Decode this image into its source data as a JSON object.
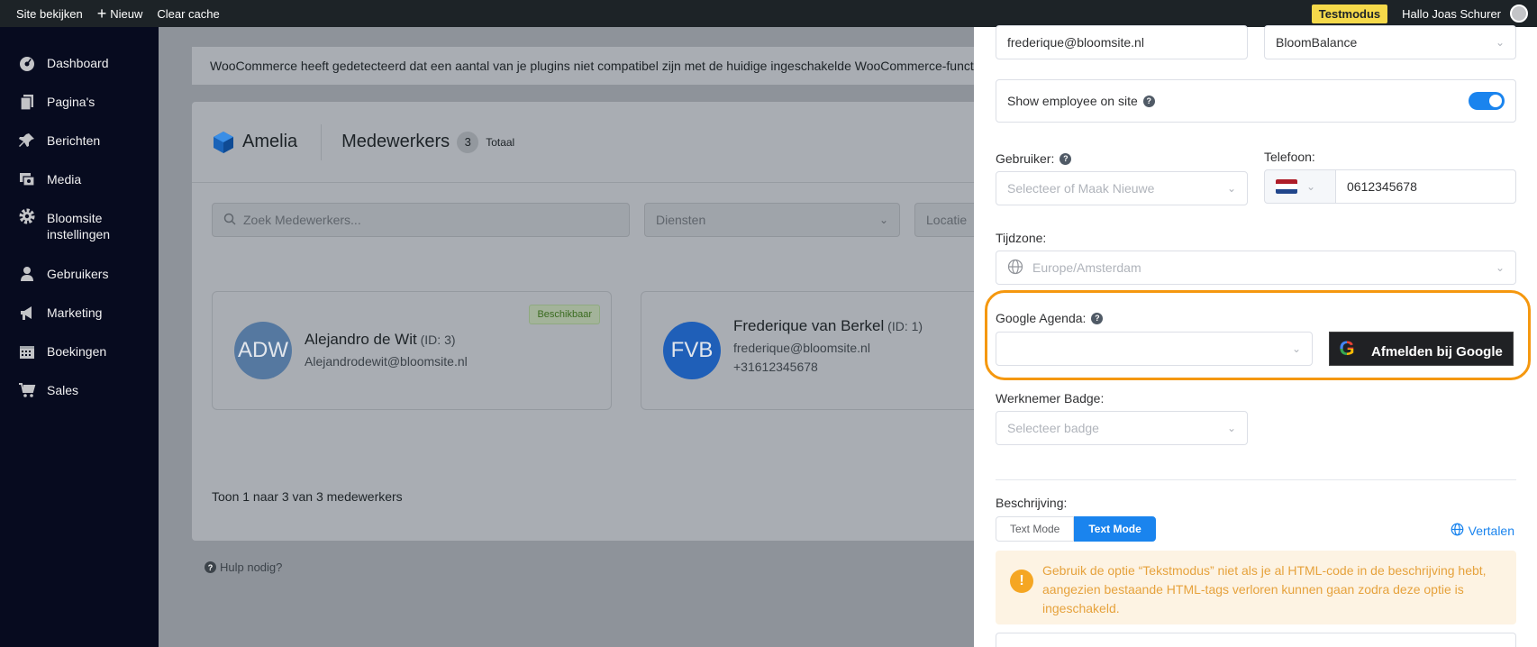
{
  "adminbar": {
    "view_site": "Site bekijken",
    "new": "Nieuw",
    "clear_cache": "Clear cache",
    "test_mode": "Testmodus",
    "greeting": "Hallo Joas Schurer"
  },
  "sidebar": {
    "items": [
      {
        "label": "Dashboard",
        "icon": "dashboard-icon"
      },
      {
        "label": "Pagina's",
        "icon": "pages-icon"
      },
      {
        "label": "Berichten",
        "icon": "pin-icon"
      },
      {
        "label": "Media",
        "icon": "media-icon"
      },
      {
        "label": "Bloomsite instellingen",
        "icon": "gear-icon"
      },
      {
        "label": "Gebruikers",
        "icon": "user-icon"
      },
      {
        "label": "Marketing",
        "icon": "megaphone-icon"
      },
      {
        "label": "Boekingen",
        "icon": "calendar-icon"
      },
      {
        "label": "Sales",
        "icon": "cart-icon"
      }
    ]
  },
  "main": {
    "notice": "WooCommerce heeft gedetecteerd dat een aantal van je plugins niet compatibel zijn met de huidige ingeschakelde WooCommerce-functies",
    "logo": "Amelia",
    "title": "Medewerkers",
    "count": "3",
    "total_label": "Totaal",
    "search_placeholder": "Zoek Medewerkers...",
    "services_placeholder": "Diensten",
    "location_placeholder": "Locatie",
    "cards": [
      {
        "initials": "ADW",
        "name": "Alejandro de Wit",
        "id": "(ID: 3)",
        "email": "Alejandrodewit@bloomsite.nl",
        "phone": "",
        "badge": "Beschikbaar",
        "color": "#5578a0"
      },
      {
        "initials": "FVB",
        "name": "Frederique van Berkel",
        "id": "(ID: 1)",
        "email": "frederique@bloomsite.nl",
        "phone": "+31612345678",
        "badge": "",
        "color": "#1f5fb8"
      }
    ],
    "pager": "Toon 1 naar 3 van 3 medewerkers",
    "help": "Hulp nodig?"
  },
  "drawer": {
    "email_value": "frederique@bloomsite.nl",
    "location_value": "BloomBalance",
    "show_employee_label": "Show employee on site",
    "show_employee_on": true,
    "user_label": "Gebruiker:",
    "user_placeholder": "Selecteer of Maak Nieuwe",
    "phone_label": "Telefoon:",
    "phone_value": "0612345678",
    "timezone_label": "Tijdzone:",
    "timezone_placeholder": "Europe/Amsterdam",
    "google_label": "Google Agenda:",
    "google_button": "Afmelden bij Google",
    "badge_label": "Werknemer Badge:",
    "badge_placeholder": "Selecteer badge",
    "description_label": "Beschrijving:",
    "mode_text": "Text Mode",
    "mode_text_active": "Text Mode",
    "translate": "Vertalen",
    "warning": "Gebruik de optie “Tekstmodus” niet als je al HTML-code in de beschrijving hebt, aangezien bestaande HTML-tags verloren kunnen gaan zodra deze optie is ingeschakeld.",
    "accent_color": "#1a84ee",
    "highlight_color": "#f5980f"
  }
}
